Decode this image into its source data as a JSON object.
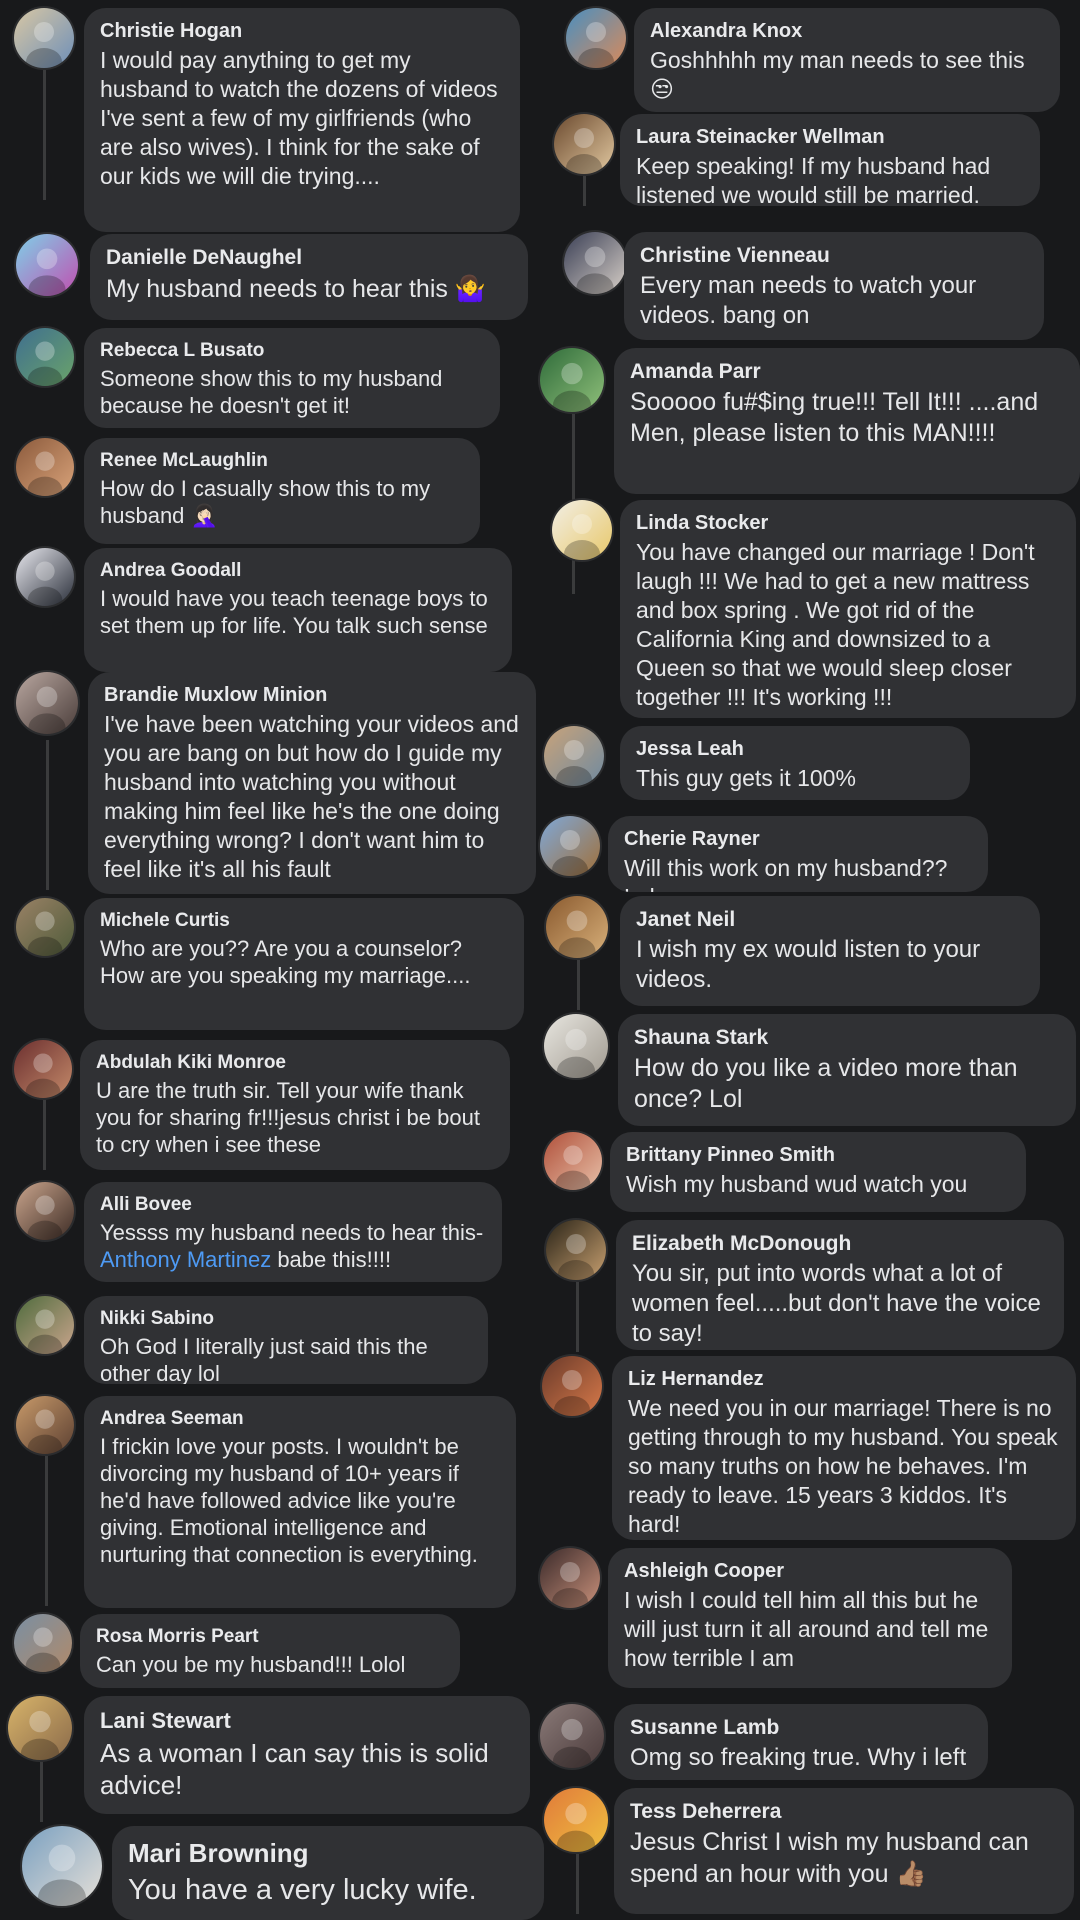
{
  "left_column": [
    {
      "name": "Christie Hogan",
      "text": "I would pay anything to get my husband to watch the dozens of videos I've sent a few of my girlfriends (who are also wives). I think for the sake of our kids we will die trying....",
      "avatar_colors": [
        "#d8c7a4",
        "#6e8fb8"
      ]
    },
    {
      "name": "Danielle DeNaughel",
      "text": "My husband needs to hear this",
      "emoji": "🤷‍♀️",
      "avatar_colors": [
        "#7fd0e8",
        "#c04fb0"
      ]
    },
    {
      "name": "Rebecca L Busato",
      "text": "Someone show this to my husband because he doesn't get it!",
      "avatar_colors": [
        "#3f6f8f",
        "#6aa36a"
      ]
    },
    {
      "name": "Renee McLaughlin",
      "text": "How do I casually show this to my husband",
      "emoji": "🤦🏻‍♀️",
      "avatar_colors": [
        "#8b5a3c",
        "#d9a37a"
      ]
    },
    {
      "name": "Andrea Goodall",
      "text": "I would have you teach teenage boys to set them up for life. You talk such sense",
      "avatar_colors": [
        "#e8e8ee",
        "#2a2f3a"
      ]
    },
    {
      "name": "Brandie Muxlow Minion",
      "text": "I've have been watching your videos and you are bang on but how do I guide my husband into watching you without making him feel like he's the one doing everything wrong? I don't want him to feel like it's all his fault",
      "avatar_colors": [
        "#b9a7a0",
        "#4a3d3a"
      ]
    },
    {
      "name": "Michele Curtis",
      "text": "Who are you?? Are you a counselor? How are you speaking my marriage....",
      "avatar_colors": [
        "#9a8266",
        "#4f5b3a"
      ]
    },
    {
      "name": "Abdulah Kiki Monroe",
      "text": "U are the truth sir.  Tell your wife thank you for sharing fr!!!jesus christ i be bout to cry when i see these",
      "avatar_colors": [
        "#6b2f2f",
        "#c48a6a"
      ]
    },
    {
      "name": "Alli Bovee",
      "text_before": "Yessss my husband needs to hear this- ",
      "mention": "Anthony Martinez",
      "text_after": " babe this!!!!",
      "avatar_colors": [
        "#caa58d",
        "#3d2c25"
      ]
    },
    {
      "name": "Nikki Sabino",
      "text": "Oh God I literally just said this the other day lol",
      "avatar_colors": [
        "#4f6b3d",
        "#caa58d"
      ]
    },
    {
      "name": "Andrea Seeman",
      "text": "I frickin love your posts. I wouldn't be divorcing my husband of 10+ years if he'd have followed advice like you're giving. Emotional intelligence and nurturing that connection is everything.",
      "avatar_colors": [
        "#c89a6a",
        "#5c4032"
      ]
    },
    {
      "name": "Rosa Morris Peart",
      "text": "Can you be my husband!!!  Lolol",
      "avatar_colors": [
        "#7a8fa3",
        "#b08a6a"
      ]
    },
    {
      "name": "Lani Stewart",
      "text": "As a woman I can say this is solid advice!",
      "avatar_colors": [
        "#d8b46a",
        "#8a6a4a"
      ]
    },
    {
      "name": "Mari Browning",
      "text": "You have a very lucky wife.",
      "avatar_colors": [
        "#7aa0c0",
        "#e6e0d8"
      ]
    }
  ],
  "right_column": [
    {
      "name": "Alexandra Knox",
      "text": "Goshhhhh my man needs to see this",
      "emoji": "😒",
      "avatar_colors": [
        "#4a8fc0",
        "#d98a5a"
      ]
    },
    {
      "name": "Laura Steinacker Wellman",
      "text": "Keep speaking! If my husband had listened we would still be married.",
      "avatar_colors": [
        "#6b4a2f",
        "#e2c8a0"
      ]
    },
    {
      "name": "Christine Vienneau",
      "text": "Every man needs to watch your videos.  bang on",
      "avatar_colors": [
        "#3a3f55",
        "#d8d0c8"
      ]
    },
    {
      "name": "Amanda Parr",
      "text": "Sooooo fu#$ing true!!!  Tell It!!!  ....and Men, please listen to this MAN!!!!",
      "avatar_colors": [
        "#2f6b3a",
        "#8fc07a"
      ]
    },
    {
      "name": "Linda Stocker",
      "text": "You have changed our marriage ! Don't laugh !!! We had to get a new mattress and box spring . We got rid of the California King and downsized to a Queen so that we would sleep closer together !!! It's working !!!",
      "avatar_colors": [
        "#f2efe6",
        "#e8c86a"
      ]
    },
    {
      "name": "Jessa Leah",
      "text": "This guy gets it 100%",
      "avatar_colors": [
        "#c9a37a",
        "#6f8aa0"
      ]
    },
    {
      "name": "Cherie Rayner",
      "text": "Will this work on my husband?? Lol",
      "avatar_colors": [
        "#7fa8d8",
        "#a0703a"
      ]
    },
    {
      "name": "Janet Neil",
      "text": "I wish my ex would listen to your videos.",
      "avatar_colors": [
        "#8a5a2f",
        "#d8b07a"
      ]
    },
    {
      "name": "Shauna Stark",
      "text": "How do you like a video more than once? Lol",
      "avatar_colors": [
        "#e8e6e0",
        "#a09a90"
      ]
    },
    {
      "name": "Brittany Pinneo Smith",
      "text": "Wish my husband wud watch you",
      "avatar_colors": [
        "#b0503a",
        "#e8c0a8"
      ]
    },
    {
      "name": "Elizabeth McDonough",
      "text": "You sir, put into words what a lot of women feel.....but don't have the voice to say!",
      "avatar_colors": [
        "#2a2418",
        "#c8a070"
      ]
    },
    {
      "name": "Liz Hernandez",
      "text": "We need you in our marriage! There is no getting through to my husband. You speak so many truths on how he behaves. I'm ready to leave. 15 years 3 kiddos. It's hard!",
      "avatar_colors": [
        "#6a3a2a",
        "#d87a4a"
      ]
    },
    {
      "name": "Ashleigh Cooper",
      "text": "I wish I could tell him all this but he will just turn it all around and tell me how terrible I am",
      "avatar_colors": [
        "#3a2a2a",
        "#c8907a"
      ]
    },
    {
      "name": "Susanne Lamb",
      "text": "Omg so freaking true. Why i left",
      "avatar_colors": [
        "#8a7a78",
        "#4a3a3a"
      ]
    },
    {
      "name": "Tess Deherrera",
      "text": "Jesus Christ I wish my husband can spend an hour with you",
      "emoji": "👍🏽",
      "avatar_colors": [
        "#e07a3a",
        "#f0c040"
      ]
    }
  ]
}
